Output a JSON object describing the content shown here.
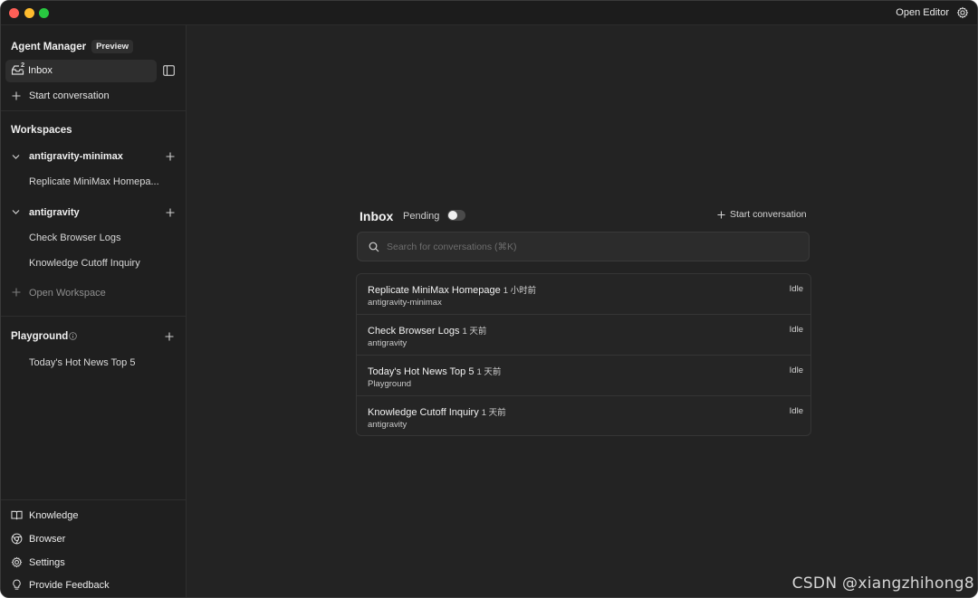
{
  "titlebar": {
    "open_editor_label": "Open Editor",
    "settings_icon": "gear-icon"
  },
  "sidebar": {
    "app_title": "Agent Manager",
    "badge": "Preview",
    "inbox": {
      "label": "Inbox",
      "count": "2"
    },
    "start_conversation": "Start conversation",
    "workspaces_title": "Workspaces",
    "workspaces": [
      {
        "name": "antigravity-minimax",
        "conversations": [
          "Replicate MiniMax Homepa..."
        ]
      },
      {
        "name": "antigravity",
        "conversations": [
          "Check Browser Logs",
          "Knowledge Cutoff Inquiry"
        ]
      }
    ],
    "open_workspace": "Open Workspace",
    "playground_title": "Playground",
    "playground_items": [
      "Today's Hot News Top 5"
    ],
    "footer": {
      "knowledge": "Knowledge",
      "browser": "Browser",
      "settings": "Settings",
      "feedback": "Provide Feedback"
    }
  },
  "main": {
    "inbox_title": "Inbox",
    "pending_label": "Pending",
    "pending_on": false,
    "start_conversation": "Start conversation",
    "search_placeholder": "Search for conversations (⌘K)",
    "conversations": [
      {
        "title": "Replicate MiniMax Homepage",
        "time": "1 小时前",
        "workspace": "antigravity-minimax",
        "status": "Idle"
      },
      {
        "title": "Check Browser Logs",
        "time": "1 天前",
        "workspace": "antigravity",
        "status": "Idle"
      },
      {
        "title": "Today's Hot News Top 5",
        "time": "1 天前",
        "workspace": "Playground",
        "status": "Idle"
      },
      {
        "title": "Knowledge Cutoff Inquiry",
        "time": "1 天前",
        "workspace": "antigravity",
        "status": "Idle"
      }
    ]
  },
  "watermark": "CSDN @xiangzhihong8"
}
